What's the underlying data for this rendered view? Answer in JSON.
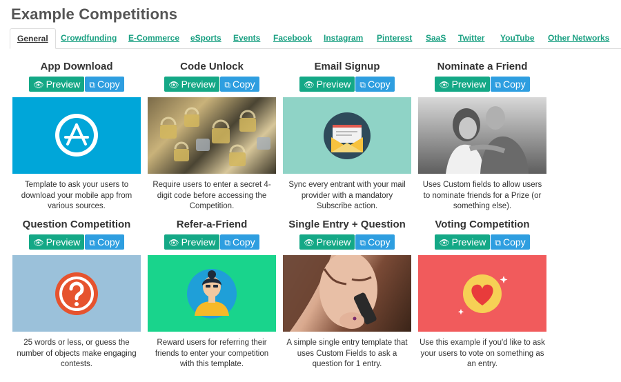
{
  "page": {
    "title": "Example Competitions"
  },
  "tabs": [
    {
      "label": "General",
      "active": true
    },
    {
      "label": "Crowdfunding"
    },
    {
      "label": "E-Commerce"
    },
    {
      "label": "eSports"
    },
    {
      "label": "Events"
    },
    {
      "label": "Facebook"
    },
    {
      "label": "Instagram"
    },
    {
      "label": "Pinterest"
    },
    {
      "label": "SaaS"
    },
    {
      "label": "Twitter"
    },
    {
      "label": "YouTube"
    },
    {
      "label": "Other Networks"
    }
  ],
  "buttons": {
    "preview": "Preview",
    "copy": "Copy",
    "preview_icon": "eye-icon",
    "copy_icon": "copy-icon"
  },
  "colors": {
    "tab_link": "#1aa082",
    "preview": "#14a886",
    "copy": "#2e9ee0"
  },
  "cards": [
    {
      "title": "App Download",
      "description": "Template to ask your users to download your mobile app from various sources.",
      "image": "app-store-icon",
      "bg": "#00a6d9"
    },
    {
      "title": "Code Unlock",
      "description": "Require users to enter a secret 4-digit code before accessing the Competition.",
      "image": "padlocks-photo",
      "bg": "#5a5440"
    },
    {
      "title": "Email Signup",
      "description": "Sync every entrant with your mail provider with a mandatory Subscribe action.",
      "image": "envelope-icon",
      "bg": "#8fd3c6"
    },
    {
      "title": "Nominate a Friend",
      "description": "Uses Custom fields to allow users to nominate friends for a Prize (or something else).",
      "image": "couple-photo",
      "bg": "#9a9a9a"
    },
    {
      "title": "Question Competition",
      "description": "25 words or less, or guess the number of objects make engaging contests.",
      "image": "question-icon",
      "bg": "#9bc1da"
    },
    {
      "title": "Refer-a-Friend",
      "description": "Reward users for referring their friends to enter your competition with this template.",
      "image": "person-icon",
      "bg": "#19d48c"
    },
    {
      "title": "Single Entry + Question",
      "description": "A simple single entry template that uses Custom Fields to ask a question for 1 entry.",
      "image": "phone-photo",
      "bg": "#b57a5e"
    },
    {
      "title": "Voting Competition",
      "description": "Use this example if you'd like to ask your users to vote on something as an entry.",
      "image": "heart-icon",
      "bg": "#f15b5c"
    }
  ]
}
